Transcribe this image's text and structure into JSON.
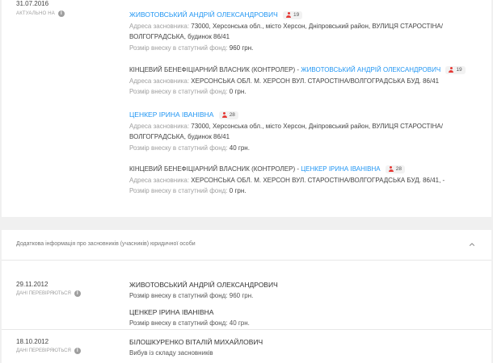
{
  "top": {
    "date": "31.07.2016",
    "status": "АКТУАЛЬНО НА",
    "entries": [
      {
        "name": "ЖИВОТОВСЬКИЙ АНДРІЙ ОЛЕКСАНДРОВИЧ",
        "age": "19",
        "addr_label": "Адреса засновника:",
        "addr_line1": "73000, Херсонська обл., місто Херсон, Дніпровський район, ВУЛИЦЯ СТАРОСТІНА/",
        "addr_line2": "ВОЛГОГРАДСЬКА, будинок 86/41",
        "cap_label": "Розмір внеску в статутний фонд:",
        "cap_value": "960 грн."
      },
      {
        "prefix": "КІНЦЕВИЙ БЕНЕФІЦІАРНИЙ ВЛАСНИК (КОНТРОЛЕР) - ",
        "name": "ЖИВОТОВСЬКИЙ АНДРІЙ ОЛЕКСАНДРОВИЧ",
        "age": "19",
        "addr_label": "Адреса засновника:",
        "addr_line1": "ХЕРСОНСЬКА ОБЛ. М. ХЕРСОН ВУЛ. СТАРОСТІНА/ВОЛГОГРАДСЬКА БУД. 86/41",
        "cap_label": "Розмір внеску в статутний фонд:",
        "cap_value": "0 грн."
      },
      {
        "name": "ЦЕНКЕР ІРИНА ІВАНІВНА",
        "age": "28",
        "addr_label": "Адреса засновника:",
        "addr_line1": "73000, Херсонська обл., місто Херсон, Дніпровський район, ВУЛИЦЯ СТАРОСТІНА/",
        "addr_line2": "ВОЛГОГРАДСЬКА, будинок 86/41",
        "cap_label": "Розмір внеску в статутний фонд:",
        "cap_value": "40 грн."
      },
      {
        "prefix": "КІНЦЕВИЙ БЕНЕФІЦІАРНИЙ ВЛАСНИК (КОНТРОЛЕР) - ",
        "name": "ЦЕНКЕР ІРИНА ІВАНІВНА",
        "age": "28",
        "addr_label": "Адреса засновника:",
        "addr_line1": "ХЕРСОНСЬКА ОБЛ. М. ХЕРСОН ВУЛ. СТАРОСТІНА/ВОЛГОГРАДСЬКА БУД. 86/41, -",
        "cap_label": "Розмір внеску в статутний фонд:",
        "cap_value": "0 грн."
      }
    ]
  },
  "additional": {
    "title": "Додаткова інформація про засновників (учасників) юридичної особи",
    "records": [
      {
        "date": "29.11.2012",
        "status": "ДАНІ ПЕРЕВІРЯЮТЬСЯ",
        "name1": "ЖИВОТОВСЬКИЙ АНДРІЙ ОЛЕКСАНДРОВИЧ",
        "meta1": "Розмір внеску в статутний фонд: 960 грн.",
        "name2": "ЦЕНКЕР ІРИНА ІВАНІВНА",
        "meta2": "Розмір внеску в статутний фонд: 40 грн."
      },
      {
        "date": "18.10.2012",
        "status": "ДАНІ ПЕРЕВІРЯЮТЬСЯ",
        "name1": "БІЛОШКУРЕНКО ВІТАЛІЙ МИХАЙЛОВИЧ",
        "meta1": "Вибув із складу засновників"
      }
    ]
  }
}
